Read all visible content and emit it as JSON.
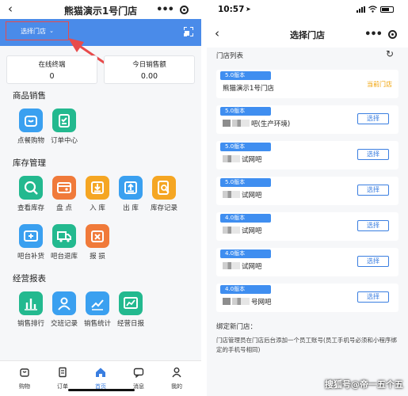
{
  "left": {
    "title": "熊猫演示1号门店",
    "store_select_label": "选择门店",
    "stats": [
      {
        "label": "在线终端",
        "value": "0"
      },
      {
        "label": "今日销售额",
        "value": "0.00"
      }
    ],
    "sections": [
      {
        "title": "商品销售",
        "items": [
          {
            "label": "点餐购物",
            "icon": "shopping-bag-icon",
            "color": "#3aa0f0"
          },
          {
            "label": "订单中心",
            "icon": "clipboard-check-icon",
            "color": "#23b98f"
          }
        ]
      },
      {
        "title": "库存管理",
        "items": [
          {
            "label": "查看库存",
            "icon": "magnifier-icon",
            "color": "#23b98f"
          },
          {
            "label": "盘 点",
            "icon": "wallet-icon",
            "color": "#f07a3a"
          },
          {
            "label": "入 库",
            "icon": "inbox-download-icon",
            "color": "#f5a623"
          },
          {
            "label": "出 库",
            "icon": "inbox-upload-icon",
            "color": "#3aa0f0"
          },
          {
            "label": "库存记录",
            "icon": "record-search-icon",
            "color": "#f5a623"
          }
        ]
      },
      {
        "title": "",
        "items": [
          {
            "label": "吧台补货",
            "icon": "restock-icon",
            "color": "#3aa0f0"
          },
          {
            "label": "吧台退库",
            "icon": "return-truck-icon",
            "color": "#23b98f"
          },
          {
            "label": "报 损",
            "icon": "damage-box-icon",
            "color": "#f07a3a"
          }
        ]
      },
      {
        "title": "经营报表",
        "items": [
          {
            "label": "销售排行",
            "icon": "bar-chart-icon",
            "color": "#23b98f"
          },
          {
            "label": "交班记录",
            "icon": "user-shift-icon",
            "color": "#3aa0f0"
          },
          {
            "label": "销售统计",
            "icon": "trend-chart-icon",
            "color": "#3aa0f0"
          },
          {
            "label": "经营日报",
            "icon": "daily-report-icon",
            "color": "#23b98f"
          }
        ]
      }
    ],
    "tabs": [
      {
        "label": "购物",
        "icon": "bag-tab-icon"
      },
      {
        "label": "订单",
        "icon": "order-tab-icon"
      },
      {
        "label": "首页",
        "icon": "home-tab-icon",
        "active": true
      },
      {
        "label": "消息",
        "icon": "message-tab-icon"
      },
      {
        "label": "我的",
        "icon": "profile-tab-icon"
      }
    ],
    "accent": "#4a8be9",
    "highlight": "#e84b4b"
  },
  "right": {
    "time": "10:57",
    "title": "选择门店",
    "list_heading": "门店列表",
    "stores": [
      {
        "version": "5.0版本",
        "name": "熊猫演示1号门店",
        "current": "当前门店"
      },
      {
        "version": "5.0版本",
        "name": "吧(生产环境)",
        "button": "选择"
      },
      {
        "version": "5.0版本",
        "name": "试网吧",
        "button": "选择"
      },
      {
        "version": "5.0版本",
        "name": "试网吧",
        "button": "选择"
      },
      {
        "version": "4.0版本",
        "name": "试网吧",
        "button": "选择"
      },
      {
        "version": "4.0版本",
        "name": "试网吧",
        "button": "选择"
      },
      {
        "version": "4.0版本",
        "name": "号网吧",
        "button": "选择"
      }
    ],
    "bind_heading": "绑定新门店：",
    "bind_text": "门店管理员在门店后台添加一个员工账号(员工手机号必须和小程序绑定的手机号相同)",
    "watermark": "搜狐号@帝一五个五",
    "accent": "#3a7ee0",
    "version_color": "#3f8ef0",
    "current_color": "#f0a000"
  }
}
